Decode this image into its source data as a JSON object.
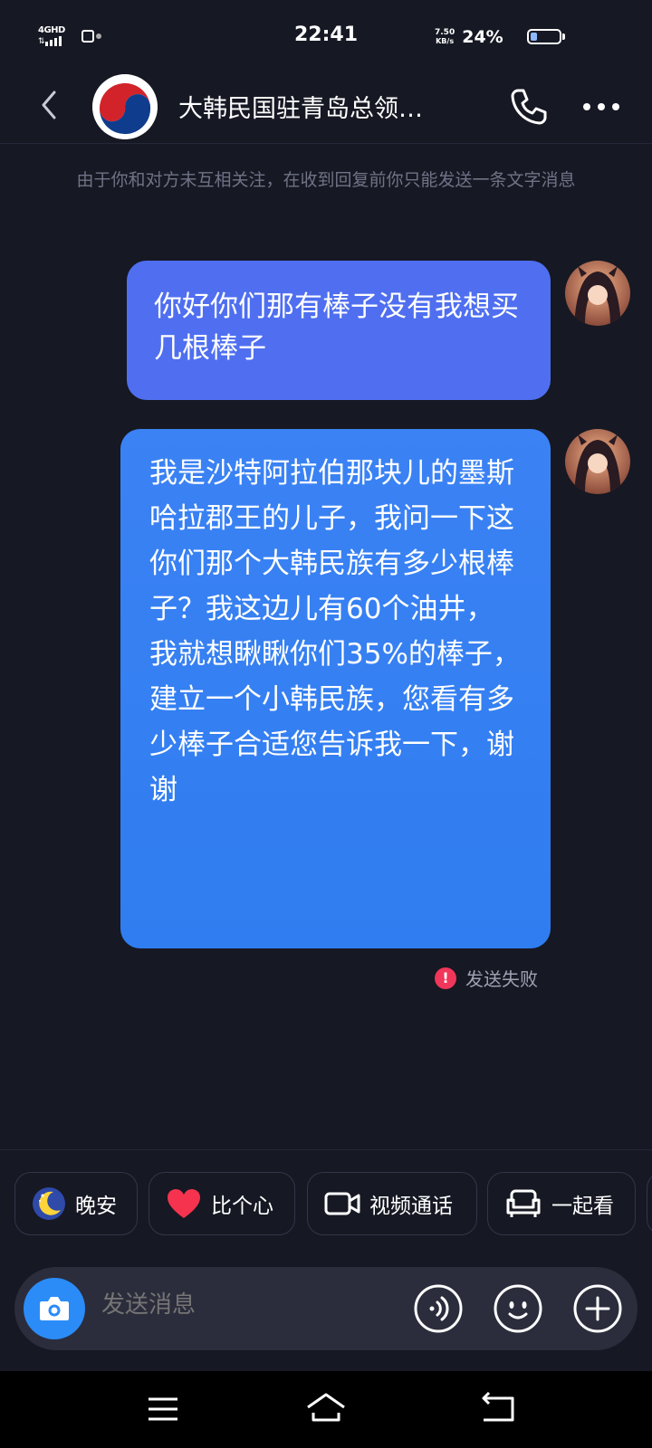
{
  "status_bar": {
    "network": "4GHD",
    "time": "22:41",
    "speed_value": "7.50",
    "speed_unit": "KB/s",
    "battery_percent": "24%",
    "battery_level": 0.24
  },
  "header": {
    "title": "大韩民国驻青岛总领…"
  },
  "notice": "由于你和对方未互相关注，在收到回复前你只能发送一条文字消息",
  "messages": [
    {
      "text": "你好你们那有棒子没有我想买几根棒子"
    },
    {
      "text": "我是沙特阿拉伯那块儿的墨斯哈拉郡王的儿子，我问一下这你们那个大韩民族有多少根棒子？我这边儿有60个油井，我就想瞅瞅你们35%的棒子，建立一个小韩民族，您看有多少棒子合适您告诉我一下，谢谢"
    }
  ],
  "send_status": "发送失败",
  "quick_replies": [
    {
      "label": "晚安",
      "icon": "moon-icon"
    },
    {
      "label": "比个心",
      "icon": "heart-icon"
    },
    {
      "label": "视频通话",
      "icon": "video-icon"
    },
    {
      "label": "一起看",
      "icon": "sofa-icon"
    }
  ],
  "input": {
    "placeholder": "发送消息"
  },
  "colors": {
    "background": "#161823",
    "bubble_1": "#4f6ff0",
    "bubble_2": "#3b82f4",
    "error": "#f0365a",
    "camera": "#2b8cf8"
  }
}
